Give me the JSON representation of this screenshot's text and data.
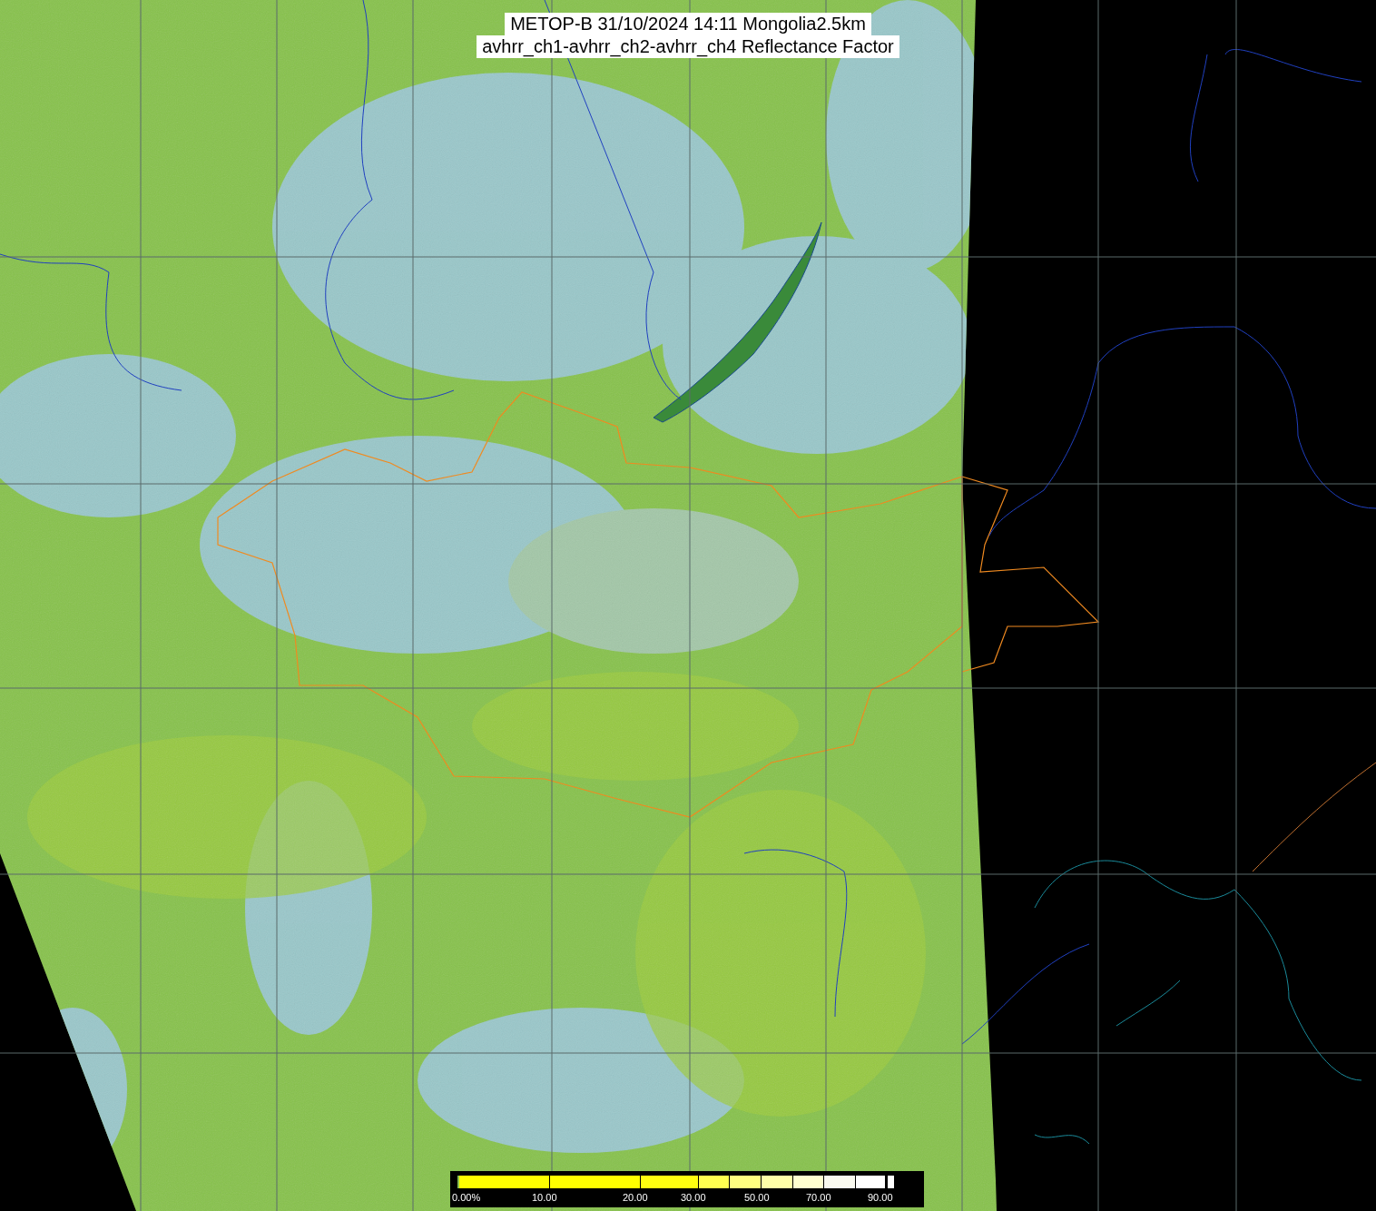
{
  "title": {
    "line_1": "METOP-B 31/10/2024 14:11 Mongolia2.5km",
    "line_2": "avhrr_ch1-avhrr_ch2-avhrr_ch4 Reflectance Factor"
  },
  "colorbar": {
    "labels": [
      "0.00%",
      "10.00",
      "20.00",
      "30.00",
      "50.00",
      "70.00",
      "90.00"
    ]
  }
}
